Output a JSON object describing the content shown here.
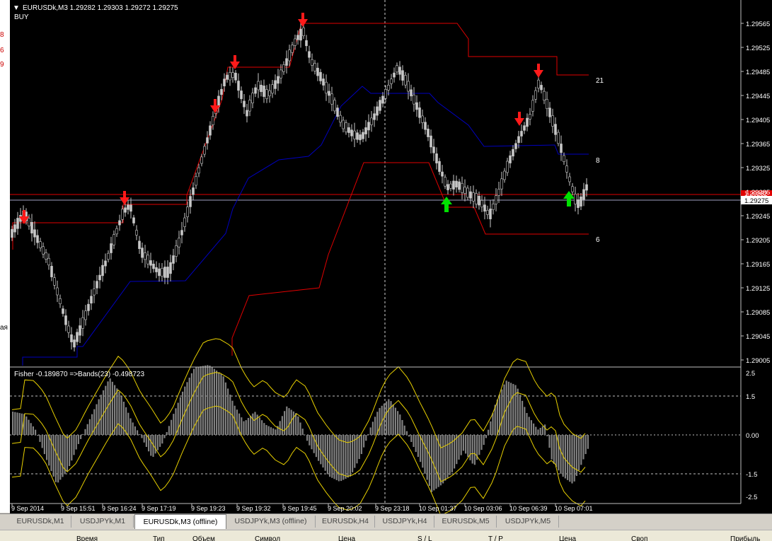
{
  "left_strip": {
    "labels": [
      "8",
      "6",
      "9",
      "ая"
    ]
  },
  "header": {
    "symbol_info": "EURUSDk,M3  1.29282 1.29303 1.29272 1.29275",
    "signal": "BUY",
    "menu_glyph": "▼"
  },
  "indicator": {
    "label": "Fisher -0.189870  =>Bands(23) -0.498723"
  },
  "level_labels": {
    "top": "21",
    "mid": "8",
    "bottom": "6"
  },
  "price_axis": [
    "1.29565",
    "1.29525",
    "1.29485",
    "1.29445",
    "1.29405",
    "1.29365",
    "1.29325",
    "1.29285",
    "1.29245",
    "1.29205",
    "1.29165",
    "1.29125",
    "1.29085",
    "1.29045",
    "1.29005"
  ],
  "current_price": "1.29275",
  "red_price_tag": "1.29282",
  "fisher_axis": [
    "2.5",
    "1.5",
    "0.00",
    "-1.5",
    "-2.5"
  ],
  "time_axis": [
    "9 Sep 2014",
    "9 Sep 15:51",
    "9 Sep 16:24",
    "9 Sep 17:19",
    "9 Sep 19:23",
    "9 Sep 19:32",
    "9 Sep 19:45",
    "9 Sep 20:02",
    "9 Sep 23:18",
    "10 Sep 01:37",
    "10 Sep 03:06",
    "10 Sep 06:39",
    "10 Sep 07:01"
  ],
  "tabs": [
    "EURUSDk,M1",
    "USDJPYk,M1",
    "EURUSDk,M3 (offline)",
    "USDJPYk,M3 (offline)",
    "EURUSDk,H4",
    "USDJPYk,H4",
    "EURUSDk,M5",
    "USDJPYk,M5"
  ],
  "active_tab": 2,
  "terminal_columns": [
    "Время",
    "Тип",
    "Объем",
    "Символ",
    "Цена",
    "S / L",
    "T / P",
    "Цена",
    "Своп",
    "Прибыль"
  ],
  "colors": {
    "background": "#000000",
    "candle": "#c8c8c8",
    "channel": "#e00000",
    "middle": "#0000c0",
    "bands": "#e8d000",
    "sell_arrow": "#ff1a1a",
    "buy_arrow": "#00e000",
    "histogram": "#808080"
  }
}
